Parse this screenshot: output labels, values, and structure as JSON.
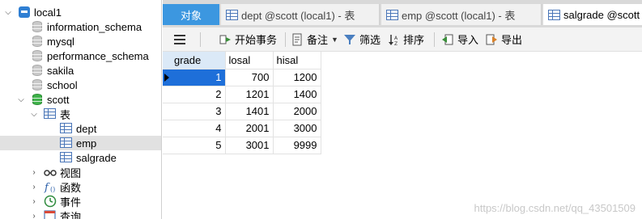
{
  "navigator": {
    "connection": "local1",
    "databases": [
      "information_schema",
      "mysql",
      "performance_schema",
      "sakila",
      "school",
      "scott"
    ],
    "tables_folder": "表",
    "tables": [
      "dept",
      "emp",
      "salgrade"
    ],
    "other_folders": [
      "视图",
      "函数",
      "事件",
      "查询"
    ]
  },
  "tabs": [
    {
      "label": "对象"
    },
    {
      "label": "dept @scott (local1) - 表"
    },
    {
      "label": "emp @scott (local1) - 表"
    },
    {
      "label": "salgrade @scott"
    }
  ],
  "toolbar": {
    "begin_tx": "开始事务",
    "note": "备注",
    "filter": "筛选",
    "sort": "排序",
    "import": "导入",
    "export": "导出"
  },
  "grid": {
    "columns": [
      "grade",
      "losal",
      "hisal"
    ],
    "rows": [
      [
        "1",
        "700",
        "1200"
      ],
      [
        "2",
        "1201",
        "1400"
      ],
      [
        "3",
        "1401",
        "2000"
      ],
      [
        "4",
        "2001",
        "3000"
      ],
      [
        "5",
        "3001",
        "9999"
      ]
    ]
  },
  "watermark": "https://blog.csdn.net/qq_43501509",
  "colors": {
    "accent": "#3c97e0",
    "selected_cell": "#1e6fd9",
    "db_green": "#3fb24a"
  }
}
